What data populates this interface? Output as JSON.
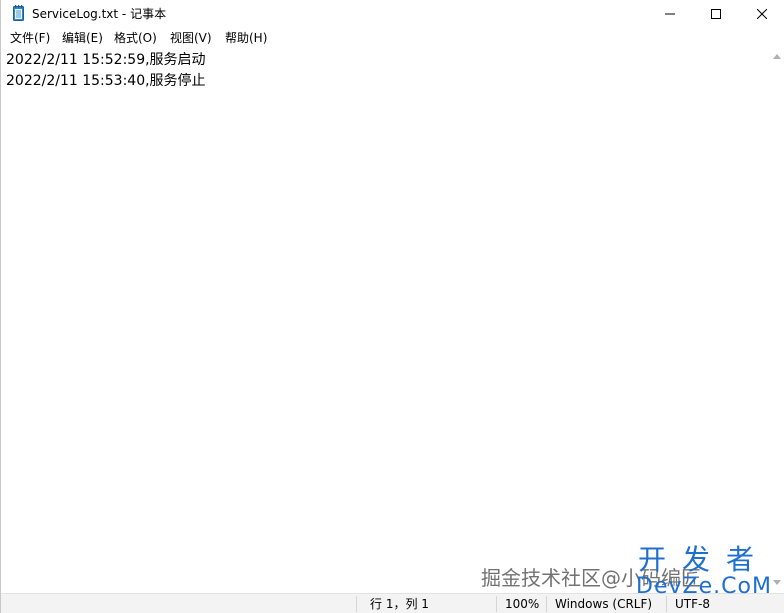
{
  "window": {
    "title": "ServiceLog.txt - 记事本",
    "app_icon": "notepad-icon"
  },
  "menu": [
    "文件(F)",
    "编辑(E)",
    "格式(O)",
    "视图(V)",
    "帮助(H)"
  ],
  "editor": {
    "lines": [
      "2022/2/11 15:52:59,服务启动",
      "2022/2/11 15:53:40,服务停止"
    ]
  },
  "status": {
    "position": "行 1，列 1",
    "zoom": "100%",
    "line_ending": "Windows (CRLF)",
    "encoding": "UTF-8"
  },
  "watermark": {
    "left": "掘金技术社区@小码编匠",
    "right_top": "开发者",
    "right_bottom": "DevZe.CoM"
  }
}
